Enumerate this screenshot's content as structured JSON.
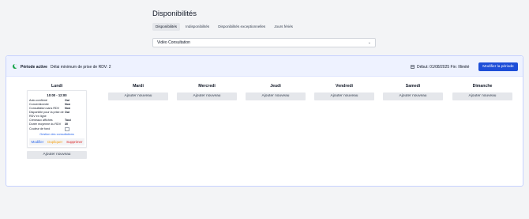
{
  "page": {
    "title": "Disponibilités"
  },
  "tabs": [
    {
      "label": "Disponibilités",
      "active": true
    },
    {
      "label": "Indisponibilités",
      "active": false
    },
    {
      "label": "Disponibilités exceptionnelles",
      "active": false
    },
    {
      "label": "Jours fériés",
      "active": false
    }
  ],
  "consultation_select": {
    "value": "Vidéo Consultation"
  },
  "period": {
    "label": "Période active",
    "delay_text": "Délai minimum de prise de RDV: 2",
    "date_range": "Début: 01/08/2025 Fin: Illimité",
    "edit_button": "Modifier la période"
  },
  "add_label": "Ajouter nouveau",
  "days": [
    {
      "name": "Lundi"
    },
    {
      "name": "Mardi"
    },
    {
      "name": "Mercredi"
    },
    {
      "name": "Jeudi"
    },
    {
      "name": "Vendredi"
    },
    {
      "name": "Samedi"
    },
    {
      "name": "Dimanche"
    }
  ],
  "slot": {
    "time": "10:00 - 12:00",
    "rows": [
      {
        "label": "Auto-confirmé",
        "value": "Oui"
      },
      {
        "label": "Conventionnée",
        "value": "Non"
      },
      {
        "label": "Consultation sans RDV",
        "value": "Non"
      },
      {
        "label": "Disponible pour la prise de RDV en ligne",
        "value": "Oui"
      },
      {
        "label": "Créneaux affichés",
        "value": "Tout"
      },
      {
        "label": "Durée moyenne du RDV",
        "value": "30"
      }
    ],
    "color_label": "Couleur de fond",
    "manage_link": "Gestion des consultations",
    "modify": "Modifier",
    "duplicate": "Dupliquer",
    "delete": "Supprimer"
  },
  "colors": {
    "primary": "#1d4ed8",
    "active_indicator": "#16a34a",
    "modify": "#2563eb",
    "duplicate": "#f59e0b",
    "delete": "#dc2626"
  }
}
